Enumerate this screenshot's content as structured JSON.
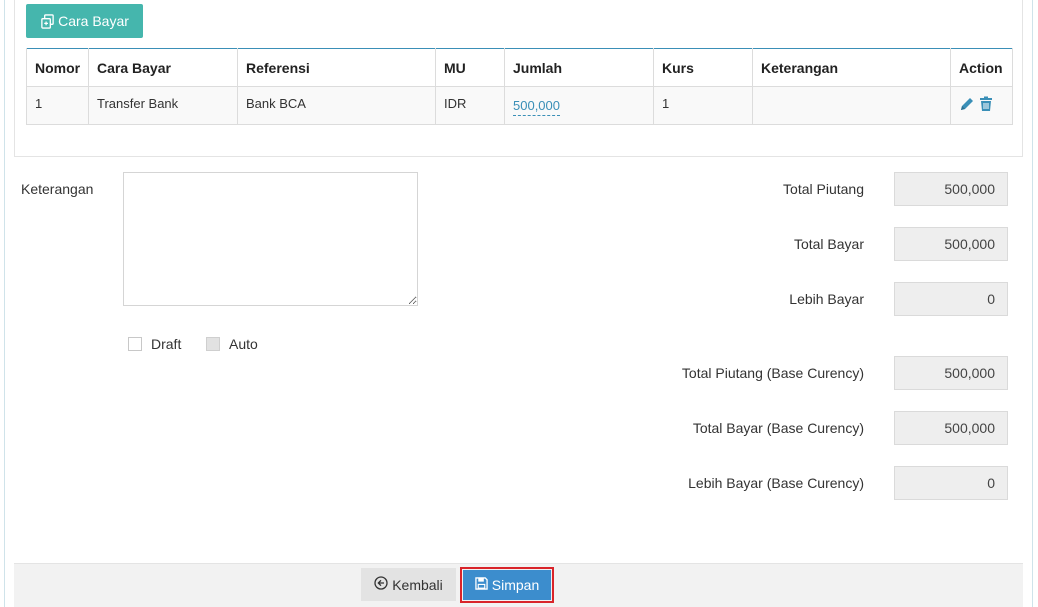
{
  "toolbar": {
    "cara_bayar_label": "Cara Bayar",
    "cara_bayar_icon": "copy-icon"
  },
  "table": {
    "headers": [
      "Nomor",
      "Cara Bayar",
      "Referensi",
      "MU",
      "Jumlah",
      "Kurs",
      "Keterangan",
      "Action"
    ],
    "rows": [
      {
        "nomor": "1",
        "cara_bayar": "Transfer Bank",
        "referensi": "Bank BCA",
        "mu": "IDR",
        "jumlah": "500,000",
        "kurs": "1",
        "keterangan": ""
      }
    ],
    "edit_icon": "pencil-icon",
    "delete_icon": "trash-icon"
  },
  "form": {
    "keterangan_label": "Keterangan",
    "keterangan_value": "",
    "draft_label": "Draft",
    "auto_label": "Auto"
  },
  "summary": {
    "total_piutang_label": "Total Piutang",
    "total_piutang": "500,000",
    "total_bayar_label": "Total Bayar",
    "total_bayar": "500,000",
    "lebih_bayar_label": "Lebih Bayar",
    "lebih_bayar": "0",
    "total_piutang_base_label": "Total Piutang (Base Curency)",
    "total_piutang_base": "500,000",
    "total_bayar_base_label": "Total Bayar (Base Curency)",
    "total_bayar_base": "500,000",
    "lebih_bayar_base_label": "Lebih Bayar (Base Curency)",
    "lebih_bayar_base": "0"
  },
  "footer": {
    "kembali_label": "Kembali",
    "simpan_label": "Simpan"
  },
  "colors": {
    "teal_button": "#45b6ad",
    "primary_blue": "#3c8dcd",
    "table_border": "#3a8fb7",
    "highlight_red": "#d9242a"
  }
}
